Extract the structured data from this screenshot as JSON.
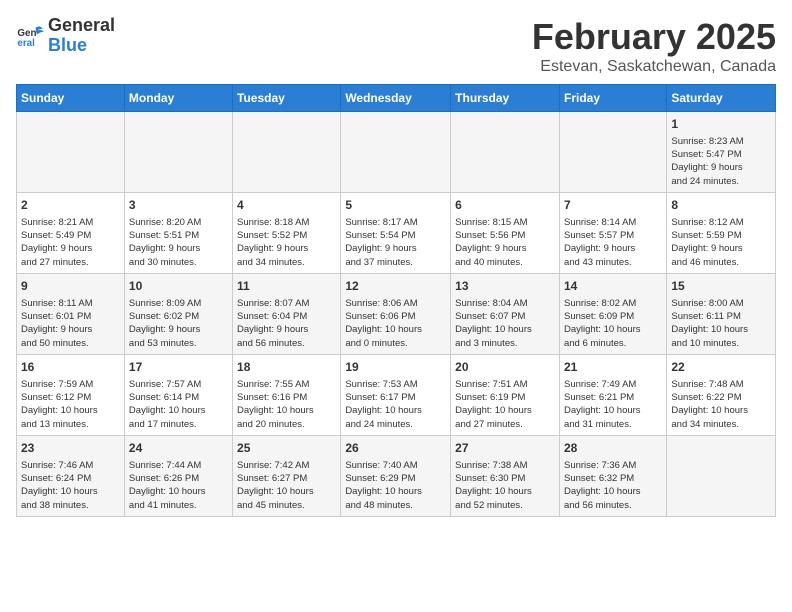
{
  "header": {
    "logo_line1": "General",
    "logo_line2": "Blue",
    "title": "February 2025",
    "subtitle": "Estevan, Saskatchewan, Canada"
  },
  "weekdays": [
    "Sunday",
    "Monday",
    "Tuesday",
    "Wednesday",
    "Thursday",
    "Friday",
    "Saturday"
  ],
  "weeks": [
    [
      {
        "day": "",
        "info": ""
      },
      {
        "day": "",
        "info": ""
      },
      {
        "day": "",
        "info": ""
      },
      {
        "day": "",
        "info": ""
      },
      {
        "day": "",
        "info": ""
      },
      {
        "day": "",
        "info": ""
      },
      {
        "day": "1",
        "info": "Sunrise: 8:23 AM\nSunset: 5:47 PM\nDaylight: 9 hours\nand 24 minutes."
      }
    ],
    [
      {
        "day": "2",
        "info": "Sunrise: 8:21 AM\nSunset: 5:49 PM\nDaylight: 9 hours\nand 27 minutes."
      },
      {
        "day": "3",
        "info": "Sunrise: 8:20 AM\nSunset: 5:51 PM\nDaylight: 9 hours\nand 30 minutes."
      },
      {
        "day": "4",
        "info": "Sunrise: 8:18 AM\nSunset: 5:52 PM\nDaylight: 9 hours\nand 34 minutes."
      },
      {
        "day": "5",
        "info": "Sunrise: 8:17 AM\nSunset: 5:54 PM\nDaylight: 9 hours\nand 37 minutes."
      },
      {
        "day": "6",
        "info": "Sunrise: 8:15 AM\nSunset: 5:56 PM\nDaylight: 9 hours\nand 40 minutes."
      },
      {
        "day": "7",
        "info": "Sunrise: 8:14 AM\nSunset: 5:57 PM\nDaylight: 9 hours\nand 43 minutes."
      },
      {
        "day": "8",
        "info": "Sunrise: 8:12 AM\nSunset: 5:59 PM\nDaylight: 9 hours\nand 46 minutes."
      }
    ],
    [
      {
        "day": "9",
        "info": "Sunrise: 8:11 AM\nSunset: 6:01 PM\nDaylight: 9 hours\nand 50 minutes."
      },
      {
        "day": "10",
        "info": "Sunrise: 8:09 AM\nSunset: 6:02 PM\nDaylight: 9 hours\nand 53 minutes."
      },
      {
        "day": "11",
        "info": "Sunrise: 8:07 AM\nSunset: 6:04 PM\nDaylight: 9 hours\nand 56 minutes."
      },
      {
        "day": "12",
        "info": "Sunrise: 8:06 AM\nSunset: 6:06 PM\nDaylight: 10 hours\nand 0 minutes."
      },
      {
        "day": "13",
        "info": "Sunrise: 8:04 AM\nSunset: 6:07 PM\nDaylight: 10 hours\nand 3 minutes."
      },
      {
        "day": "14",
        "info": "Sunrise: 8:02 AM\nSunset: 6:09 PM\nDaylight: 10 hours\nand 6 minutes."
      },
      {
        "day": "15",
        "info": "Sunrise: 8:00 AM\nSunset: 6:11 PM\nDaylight: 10 hours\nand 10 minutes."
      }
    ],
    [
      {
        "day": "16",
        "info": "Sunrise: 7:59 AM\nSunset: 6:12 PM\nDaylight: 10 hours\nand 13 minutes."
      },
      {
        "day": "17",
        "info": "Sunrise: 7:57 AM\nSunset: 6:14 PM\nDaylight: 10 hours\nand 17 minutes."
      },
      {
        "day": "18",
        "info": "Sunrise: 7:55 AM\nSunset: 6:16 PM\nDaylight: 10 hours\nand 20 minutes."
      },
      {
        "day": "19",
        "info": "Sunrise: 7:53 AM\nSunset: 6:17 PM\nDaylight: 10 hours\nand 24 minutes."
      },
      {
        "day": "20",
        "info": "Sunrise: 7:51 AM\nSunset: 6:19 PM\nDaylight: 10 hours\nand 27 minutes."
      },
      {
        "day": "21",
        "info": "Sunrise: 7:49 AM\nSunset: 6:21 PM\nDaylight: 10 hours\nand 31 minutes."
      },
      {
        "day": "22",
        "info": "Sunrise: 7:48 AM\nSunset: 6:22 PM\nDaylight: 10 hours\nand 34 minutes."
      }
    ],
    [
      {
        "day": "23",
        "info": "Sunrise: 7:46 AM\nSunset: 6:24 PM\nDaylight: 10 hours\nand 38 minutes."
      },
      {
        "day": "24",
        "info": "Sunrise: 7:44 AM\nSunset: 6:26 PM\nDaylight: 10 hours\nand 41 minutes."
      },
      {
        "day": "25",
        "info": "Sunrise: 7:42 AM\nSunset: 6:27 PM\nDaylight: 10 hours\nand 45 minutes."
      },
      {
        "day": "26",
        "info": "Sunrise: 7:40 AM\nSunset: 6:29 PM\nDaylight: 10 hours\nand 48 minutes."
      },
      {
        "day": "27",
        "info": "Sunrise: 7:38 AM\nSunset: 6:30 PM\nDaylight: 10 hours\nand 52 minutes."
      },
      {
        "day": "28",
        "info": "Sunrise: 7:36 AM\nSunset: 6:32 PM\nDaylight: 10 hours\nand 56 minutes."
      },
      {
        "day": "",
        "info": ""
      }
    ]
  ]
}
